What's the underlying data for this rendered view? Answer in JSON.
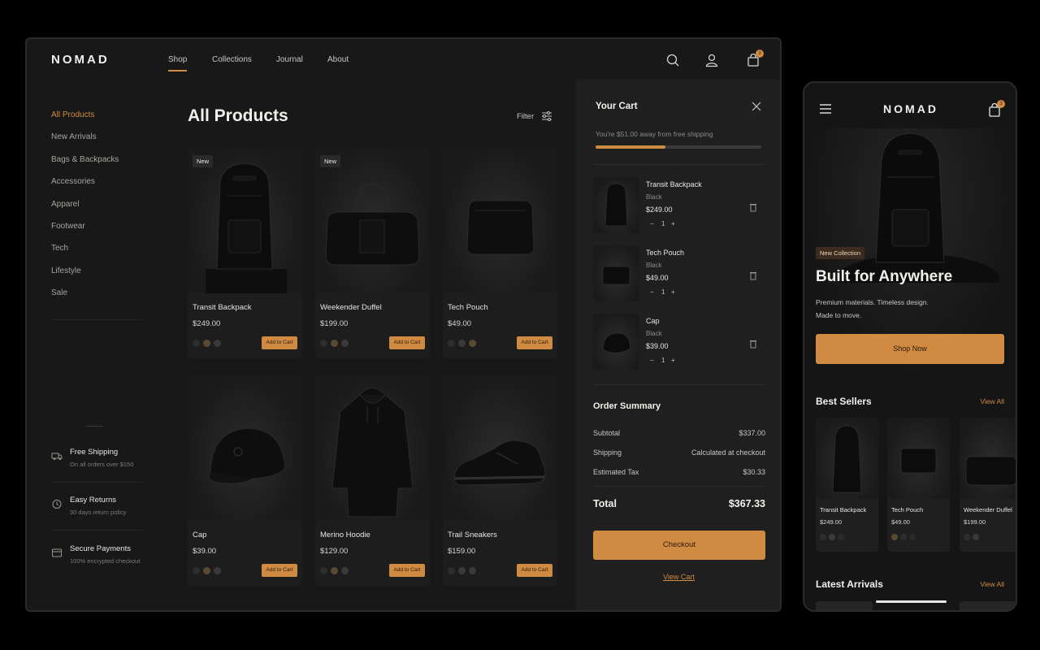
{
  "brand": "NOMAD",
  "colors": {
    "accent": "#d08b43",
    "background": "#181818",
    "panel": "#1f1f1f"
  },
  "nav": {
    "items": [
      "Shop",
      "Collections",
      "Journal",
      "About"
    ],
    "active": "Shop"
  },
  "header": {
    "cart_count": "3",
    "icons": [
      "search-icon",
      "user-icon",
      "bag-icon"
    ]
  },
  "sidebar": {
    "categories": [
      "All Products",
      "New Arrivals",
      "Bags & Backpacks",
      "Accessories",
      "Apparel",
      "Footwear",
      "Tech",
      "Lifestyle",
      "Sale"
    ],
    "active": "All Products",
    "perks": [
      {
        "title": "Free Shipping",
        "subtitle": "On all orders over $150",
        "icon": "truck-icon"
      },
      {
        "title": "Easy Returns",
        "subtitle": "30 days return policy",
        "icon": "returns-icon"
      },
      {
        "title": "Secure Payments",
        "subtitle": "100% encrypted checkout",
        "icon": "card-icon"
      }
    ]
  },
  "main": {
    "title": "All Products",
    "filter_label": "Filter",
    "add_label": "Add to Cart",
    "products": [
      {
        "name": "Transit Backpack",
        "price": "$249.00",
        "tag": "New",
        "icon": "backpack-icon",
        "swatches": [
          "#2d2d2d",
          "#5a4a32",
          "#3a3a3a"
        ]
      },
      {
        "name": "Weekender Duffel",
        "price": "$199.00",
        "tag": "New",
        "icon": "duffel-icon",
        "swatches": [
          "#2d2d2d",
          "#5a4a32",
          "#3a3a3a"
        ]
      },
      {
        "name": "Tech Pouch",
        "price": "$49.00",
        "tag": "",
        "icon": "pouch-icon",
        "swatches": [
          "#2d2d2d",
          "#3a3a3a",
          "#5a4a32"
        ]
      },
      {
        "name": "Cap",
        "price": "$39.00",
        "tag": "",
        "icon": "cap-icon",
        "swatches": [
          "#2d2d2d",
          "#5a4a32",
          "#3a3a3a"
        ]
      },
      {
        "name": "Merino Hoodie",
        "price": "$129.00",
        "tag": "",
        "icon": "hoodie-icon",
        "swatches": [
          "#2d2d2d",
          "#5a4a32",
          "#3a3a3a"
        ]
      },
      {
        "name": "Trail Sneakers",
        "price": "$159.00",
        "tag": "",
        "icon": "sneaker-icon",
        "swatches": [
          "#2d2d2d",
          "#3a3a3a",
          "#3a3a3a"
        ]
      }
    ]
  },
  "cart": {
    "title": "Your Cart",
    "shipping_note": "You're $51.00 away from free shipping",
    "shipping_progress": 0.42,
    "items": [
      {
        "name": "Transit Backpack",
        "variant": "Black",
        "price": "$249.00",
        "qty": "1",
        "icon": "backpack-icon"
      },
      {
        "name": "Tech Pouch",
        "variant": "Black",
        "price": "$49.00",
        "qty": "1",
        "icon": "pouch-icon"
      },
      {
        "name": "Cap",
        "variant": "Black",
        "price": "$39.00",
        "qty": "1",
        "icon": "cap-icon"
      }
    ],
    "summary_title": "Order Summary",
    "subtotal_label": "Subtotal",
    "subtotal": "$337.00",
    "shipping_label": "Shipping",
    "shipping": "Calculated at checkout",
    "tax_label": "Estimated Tax",
    "tax": "$30.33",
    "total_label": "Total",
    "total": "$367.33",
    "checkout_label": "Checkout",
    "view_cart_label": "View Cart",
    "qty_minus": "−",
    "qty_plus": "+"
  },
  "mobile": {
    "brand": "NOMAD",
    "cart_count": "3",
    "hero_tag": "New Collection",
    "hero_title": "Built for Anywhere",
    "hero_sub_1": "Premium materials. Timeless design.",
    "hero_sub_2": "Made to move.",
    "shop_now": "Shop Now",
    "best_sellers": "Best Sellers",
    "latest": "Latest Arrivals",
    "view_all": "View All",
    "cards": [
      {
        "name": "Transit Backpack",
        "price": "$249.00",
        "icon": "backpack-icon"
      },
      {
        "name": "Tech Pouch",
        "price": "$49.00",
        "icon": "pouch-icon"
      },
      {
        "name": "Weekender Duffel",
        "price": "$199.00",
        "icon": "duffel-icon"
      }
    ]
  }
}
